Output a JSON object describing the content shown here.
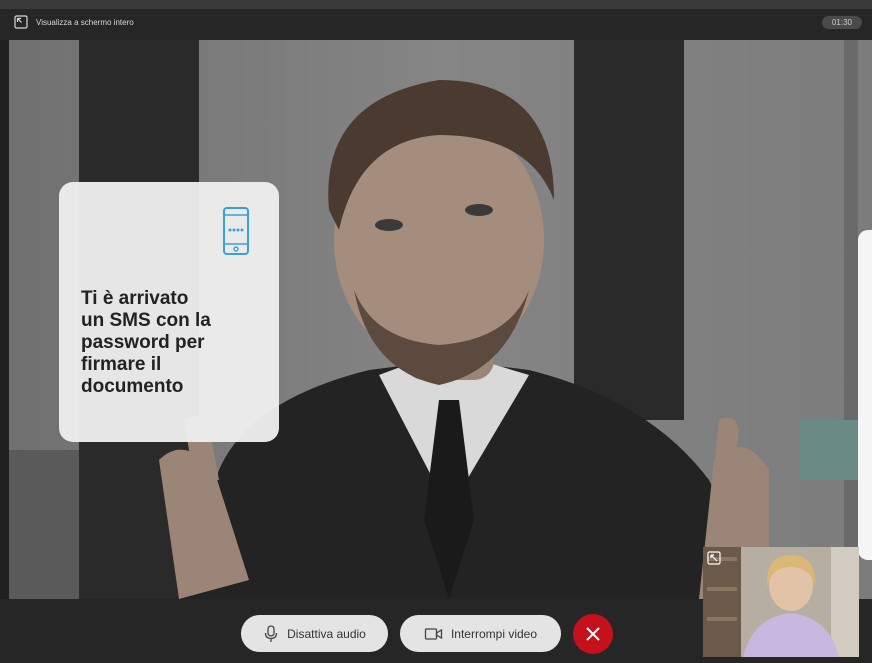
{
  "topbar": {
    "fullscreen_label": "Visualizza a schermo intero",
    "fullscreen_icon": "fullscreen-icon",
    "timer": "01:30"
  },
  "overlay": {
    "icon": "smartphone-icon",
    "message": "Ti è arrivato\nun SMS con la\npassword per\nfirmare il\ndocumento"
  },
  "controls": {
    "mute_label": "Disattiva audio",
    "mute_icon": "microphone-icon",
    "video_label": "Interrompi video",
    "video_icon": "video-camera-icon",
    "end_icon": "close-icon",
    "end_color": "#c4111b"
  },
  "self_view": {
    "expand_icon": "expand-icon"
  },
  "colors": {
    "bar": "#262626",
    "pill": "#e4e4e4",
    "card": "#eeeeee",
    "accent_icon": "#3aa0d8"
  }
}
